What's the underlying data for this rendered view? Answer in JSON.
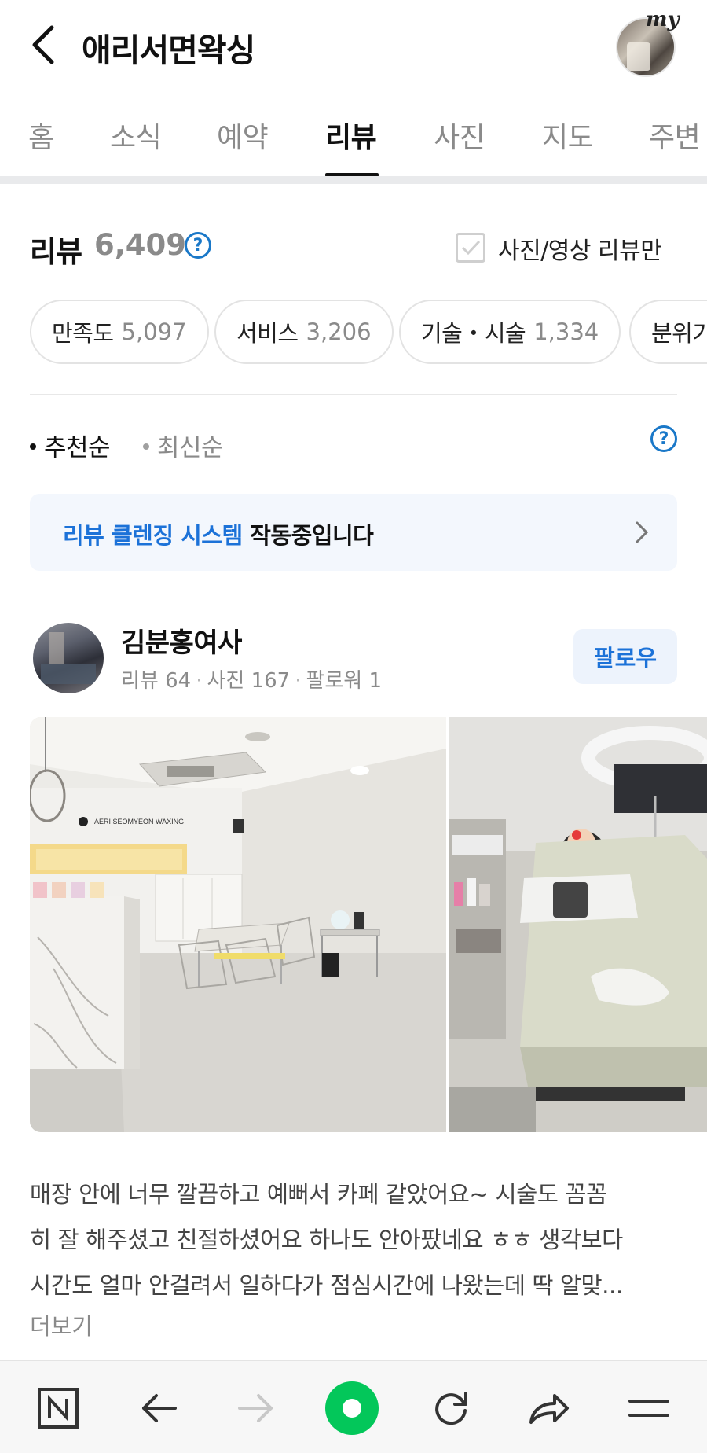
{
  "header": {
    "title": "애리서면왁싱",
    "my_label": "my"
  },
  "tabs": [
    {
      "label": "홈",
      "active": false
    },
    {
      "label": "소식",
      "active": false
    },
    {
      "label": "예약",
      "active": false
    },
    {
      "label": "리뷰",
      "active": true
    },
    {
      "label": "사진",
      "active": false
    },
    {
      "label": "지도",
      "active": false
    },
    {
      "label": "주변",
      "active": false
    }
  ],
  "reviews": {
    "title": "리뷰",
    "count": "6,409",
    "help_glyph": "?",
    "photo_only_label": "사진/영상 리뷰만",
    "photo_only_checked": false
  },
  "chips": [
    {
      "label": "만족도",
      "count": "5,097"
    },
    {
      "label": "서비스",
      "count": "3,206"
    },
    {
      "label": "기술・시술",
      "count": "1,334"
    },
    {
      "label": "분위기",
      "count": ""
    }
  ],
  "sort": {
    "options": [
      {
        "label": "추천순",
        "active": true
      },
      {
        "label": "최신순",
        "active": false
      }
    ]
  },
  "banner": {
    "highlight": "리뷰 클렌징 시스템",
    "rest": " 작동중입니다"
  },
  "review": {
    "author": "김분홍여사",
    "reviews_label": "리뷰 64",
    "photos_label": "사진 167",
    "followers_label": "팔로워 1",
    "separator": "·",
    "follow_label": "팔로우",
    "photo_signage": "AERI SEOMYEON WAXING",
    "text_lines": [
      "매장 안에 너무 깔끔하고 예뻐서 카페 같았어요~ 시술도 꼼꼼",
      "히 잘 해주셨고 친절하셨어요 하나도 안아팠네요 ㅎㅎ 생각보다",
      "시간도 얼마 안걸려서 일하다가 점심시간에 나왔는데 딱 알맞..."
    ],
    "more_label": "더보기"
  },
  "colors": {
    "accent_blue": "#1c72d8",
    "naver_green": "#03c75a",
    "text_primary": "#111111",
    "text_secondary": "#8a8a8a"
  },
  "bottom_bar": {
    "icons": [
      "naver-n-icon",
      "back-arrow-icon",
      "forward-arrow-icon",
      "green-dot-icon",
      "refresh-icon",
      "share-icon",
      "menu-icon"
    ]
  }
}
